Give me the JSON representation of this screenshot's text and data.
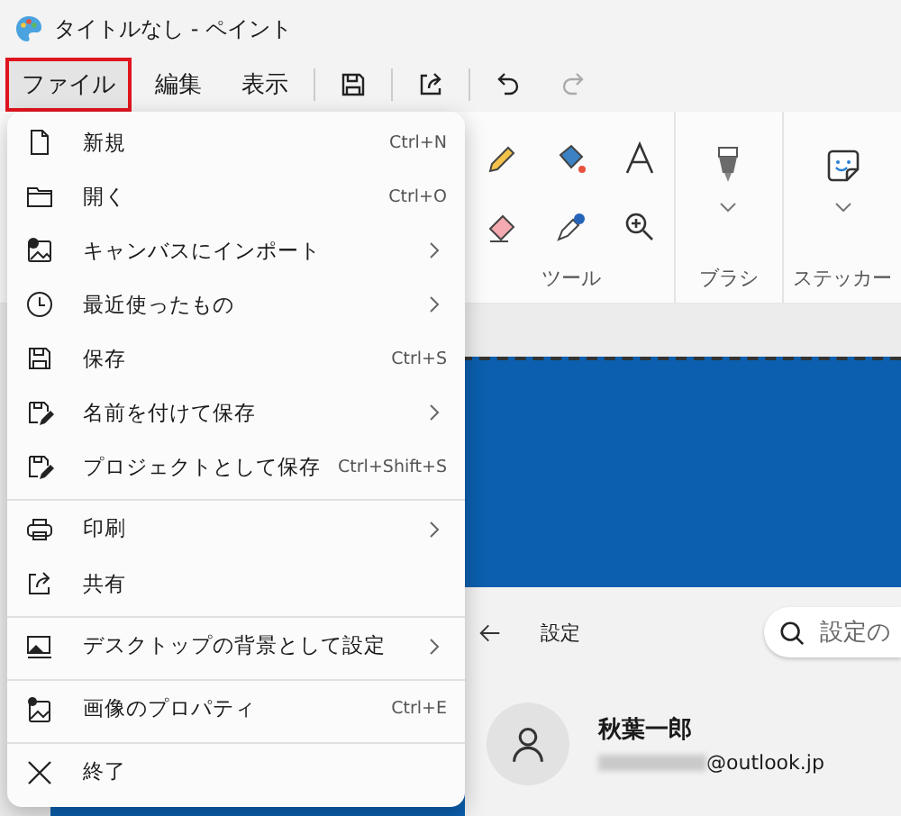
{
  "window": {
    "title": "タイトルなし - ペイント"
  },
  "menubar": [
    {
      "label": "ファイル",
      "selected": true
    },
    {
      "label": "編集",
      "selected": false
    },
    {
      "label": "表示",
      "selected": false
    }
  ],
  "quick_actions": [
    {
      "kind": "save",
      "disabled": false
    },
    {
      "kind": "share",
      "disabled": false
    },
    {
      "kind": "undo",
      "disabled": false
    },
    {
      "kind": "redo",
      "disabled": true
    }
  ],
  "file_menu": [
    {
      "label": "新規",
      "shortcut": "Ctrl+N",
      "submenu": false,
      "divider_before": false
    },
    {
      "label": "開く",
      "shortcut": "Ctrl+O",
      "submenu": false,
      "divider_before": false
    },
    {
      "label": "キャンバスにインポート",
      "submenu": true,
      "divider_before": false
    },
    {
      "label": "最近使ったもの",
      "submenu": true,
      "divider_before": false
    },
    {
      "label": "保存",
      "shortcut": "Ctrl+S",
      "submenu": false,
      "divider_before": false
    },
    {
      "label": "名前を付けて保存",
      "submenu": true,
      "divider_before": false
    },
    {
      "label": "プロジェクトとして保存",
      "shortcut": "Ctrl+Shift+S",
      "submenu": false,
      "divider_before": false
    },
    {
      "label": "印刷",
      "submenu": true,
      "divider_before": true
    },
    {
      "label": "共有",
      "submenu": false,
      "divider_before": false
    },
    {
      "label": "デスクトップの背景として設定",
      "submenu": true,
      "divider_before": true
    },
    {
      "label": "画像のプロパティ",
      "shortcut": "Ctrl+E",
      "submenu": false,
      "divider_before": true
    },
    {
      "label": "終了",
      "submenu": false,
      "divider_before": true
    }
  ],
  "ribbon": {
    "groups": [
      {
        "kind": "tools",
        "label": "ツール"
      },
      {
        "kind": "brush",
        "label": "ブラシ"
      },
      {
        "kind": "sticker",
        "label": "ステッカー"
      }
    ]
  },
  "canvas_image": {
    "back_label": "設定",
    "search": {
      "placeholder": "設定の"
    },
    "user_name": "秋葉一郎",
    "email": "@outlook.jp"
  }
}
